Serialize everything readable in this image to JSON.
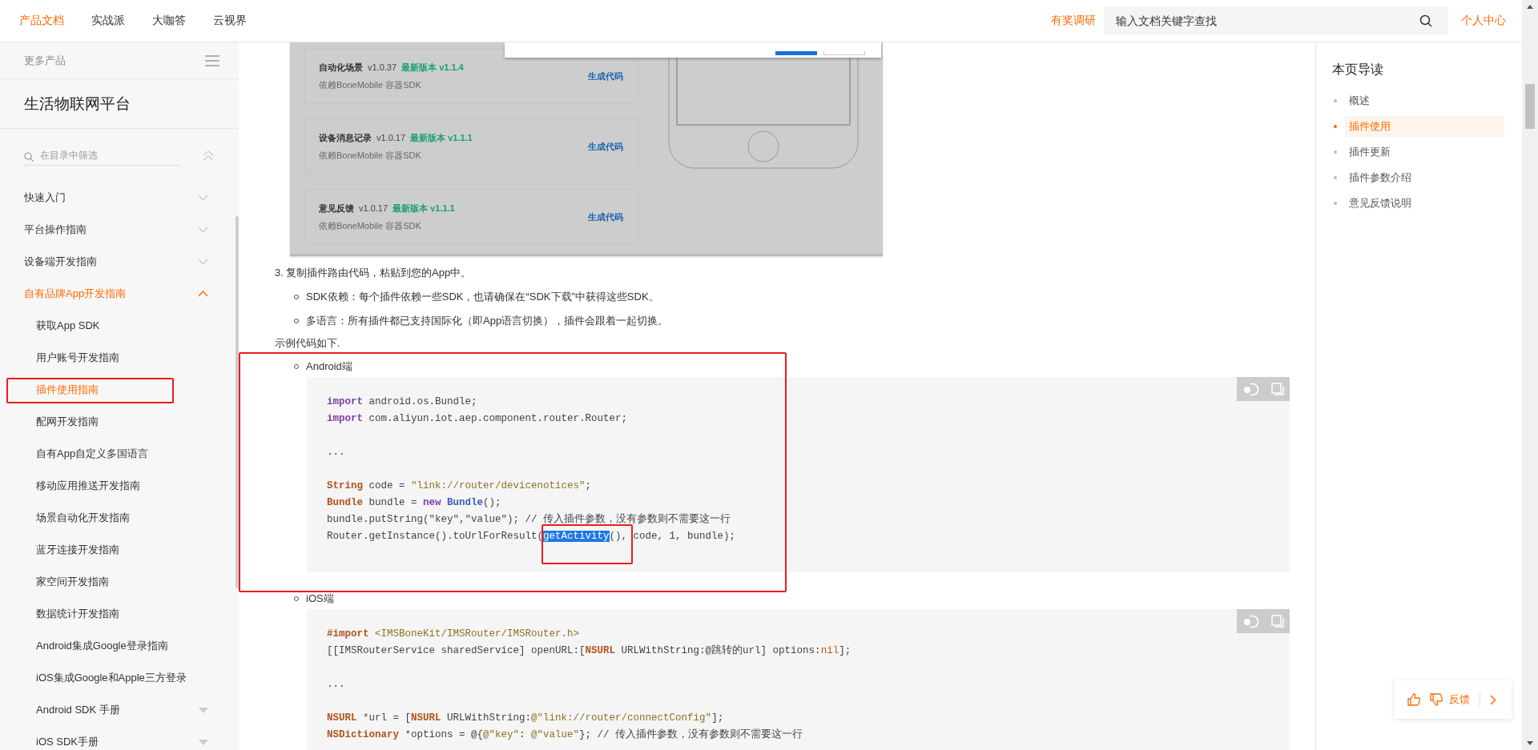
{
  "top_nav": {
    "tabs": [
      {
        "label": "产品文档",
        "selected": true
      },
      {
        "label": "实战派",
        "selected": false
      },
      {
        "label": "大咖答",
        "selected": false
      },
      {
        "label": "云视界",
        "selected": false
      }
    ],
    "survey_link": "有奖调研",
    "search": {
      "placeholder": "输入文档关键字查找"
    },
    "user_link": "个人中心"
  },
  "sidebar": {
    "more_products": "更多产品",
    "title": "生活物联网平台",
    "filter": {
      "placeholder": "在目录中筛选"
    },
    "items": [
      {
        "label": "快速入门",
        "expanded": false
      },
      {
        "label": "平台操作指南",
        "expanded": false
      },
      {
        "label": "设备端开发指南",
        "expanded": false
      },
      {
        "label": "自有品牌App开发指南",
        "expanded": true,
        "children": [
          {
            "label": "获取App SDK",
            "kind": "page",
            "selected": false
          },
          {
            "label": "用户账号开发指南",
            "kind": "page",
            "selected": false
          },
          {
            "label": "插件使用指南",
            "kind": "page",
            "selected": true
          },
          {
            "label": "配网开发指南",
            "kind": "page",
            "selected": false
          },
          {
            "label": "自有App自定义多国语言",
            "kind": "page",
            "selected": false
          },
          {
            "label": "移动应用推送开发指南",
            "kind": "page",
            "selected": false
          },
          {
            "label": "场景自动化开发指南",
            "kind": "page",
            "selected": false
          },
          {
            "label": "蓝牙连接开发指南",
            "kind": "page",
            "selected": false
          },
          {
            "label": "家空间开发指南",
            "kind": "page",
            "selected": false
          },
          {
            "label": "数据统计开发指南",
            "kind": "page",
            "selected": false
          },
          {
            "label": "Android集成Google登录指南",
            "kind": "page",
            "selected": false
          },
          {
            "label": "iOS集成Google和Apple三方登录",
            "kind": "page",
            "selected": false
          },
          {
            "label": "Android SDK 手册",
            "kind": "folder",
            "selected": false
          },
          {
            "label": "iOS SDK手册",
            "kind": "folder",
            "selected": false
          }
        ]
      }
    ]
  },
  "content": {
    "screenshot": {
      "plugins": [
        {
          "name": "自动化场景",
          "version": "v1.0.37",
          "latest": "最新版本 v1.1.4",
          "dependency": "依赖BoneMobile 容器SDK",
          "action": "生成代码"
        },
        {
          "name": "设备消息记录",
          "version": "v1.0.17",
          "latest": "最新版本 v1.1.1",
          "dependency": "依赖BoneMobile 容器SDK",
          "action": "生成代码"
        },
        {
          "name": "意见反馈",
          "version": "v1.0.17",
          "latest": "最新版本 v1.1.1",
          "dependency": "依赖BoneMobile 容器SDK",
          "action": "生成代码"
        }
      ]
    },
    "step": {
      "number": "3.",
      "text": "复制插件路由代码，粘贴到您的App中。",
      "bullets": [
        "SDK依赖：每个插件依赖一些SDK，也请确保在“SDK下载”中获得这些SDK。",
        "多语言：所有插件都已支持国际化（即App语言切换），插件会跟着一起切换。"
      ]
    },
    "example_intro": "示例代码如下.",
    "code_samples": [
      {
        "platform": "Android端",
        "lines": [
          {
            "kind": "code",
            "tokens": [
              {
                "kind": "keyword",
                "text": "import"
              },
              {
                "kind": "plain",
                "text": " android.os.Bundle;"
              }
            ]
          },
          {
            "kind": "code",
            "tokens": [
              {
                "kind": "keyword",
                "text": "import"
              },
              {
                "kind": "plain",
                "text": " com.aliyun.iot.aep.component.router.Router;"
              }
            ]
          },
          {
            "kind": "blank"
          },
          {
            "kind": "code",
            "tokens": [
              {
                "kind": "plain",
                "text": "..."
              }
            ]
          },
          {
            "kind": "blank"
          },
          {
            "kind": "code",
            "tokens": [
              {
                "kind": "type",
                "text": "String"
              },
              {
                "kind": "plain",
                "text": " code = "
              },
              {
                "kind": "string",
                "text": "\"link://router/devicenotices\""
              },
              {
                "kind": "plain",
                "text": ";"
              }
            ]
          },
          {
            "kind": "code",
            "tokens": [
              {
                "kind": "type",
                "text": "Bundle"
              },
              {
                "kind": "plain",
                "text": " bundle = "
              },
              {
                "kind": "keyword",
                "text": "new"
              },
              {
                "kind": "class",
                "text": " Bundle"
              },
              {
                "kind": "plain",
                "text": "();"
              }
            ]
          },
          {
            "kind": "code",
            "tokens": [
              {
                "kind": "plain",
                "text": "bundle.putString(\"key\",\"value\"); // 传入插件参数，没有参数则不需要这一行"
              }
            ]
          },
          {
            "kind": "code",
            "tokens": [
              {
                "kind": "plain",
                "text": "Router.getInstance().toUrlForResult("
              },
              {
                "kind": "selection",
                "text": "getActivity"
              },
              {
                "kind": "plain",
                "text": "(), code, 1, bundle);"
              }
            ]
          }
        ]
      },
      {
        "platform": "iOS端",
        "lines": [
          {
            "kind": "code",
            "tokens": [
              {
                "kind": "type",
                "text": "#import"
              },
              {
                "kind": "string",
                "text": " <IMSBoneKit/IMSRouter/IMSRouter.h>"
              }
            ]
          },
          {
            "kind": "code",
            "tokens": [
              {
                "kind": "plain",
                "text": "[[IMSRouterService sharedService] openURL:["
              },
              {
                "kind": "type",
                "text": "NSURL"
              },
              {
                "kind": "plain",
                "text": " URLWithString:@跳转的url] options:"
              },
              {
                "kind": "literal",
                "text": "nil"
              },
              {
                "kind": "plain",
                "text": "];"
              }
            ]
          },
          {
            "kind": "blank"
          },
          {
            "kind": "code",
            "tokens": [
              {
                "kind": "plain",
                "text": "..."
              }
            ]
          },
          {
            "kind": "blank"
          },
          {
            "kind": "code",
            "tokens": [
              {
                "kind": "type",
                "text": "NSURL"
              },
              {
                "kind": "plain",
                "text": " *url = ["
              },
              {
                "kind": "type",
                "text": "NSURL"
              },
              {
                "kind": "plain",
                "text": " URLWithString:"
              },
              {
                "kind": "string",
                "text": "@\"link://router/connectConfig\""
              },
              {
                "kind": "plain",
                "text": "];"
              }
            ]
          },
          {
            "kind": "code",
            "tokens": [
              {
                "kind": "type",
                "text": "NSDictionary"
              },
              {
                "kind": "plain",
                "text": " *options = @{"
              },
              {
                "kind": "string",
                "text": "@\"key\""
              },
              {
                "kind": "plain",
                "text": ": "
              },
              {
                "kind": "string",
                "text": "@\"value\""
              },
              {
                "kind": "plain",
                "text": "}; // 传入插件参数，没有参数则不需要这一行"
              }
            ]
          }
        ]
      }
    ]
  },
  "toc": {
    "title": "本页导读",
    "items": [
      {
        "label": "概述",
        "selected": false
      },
      {
        "label": "插件使用",
        "selected": true
      },
      {
        "label": "插件更新",
        "selected": false
      },
      {
        "label": "插件参数介绍",
        "selected": false
      },
      {
        "label": "意见反馈说明",
        "selected": false
      }
    ]
  },
  "feedback": {
    "label": "反馈"
  }
}
